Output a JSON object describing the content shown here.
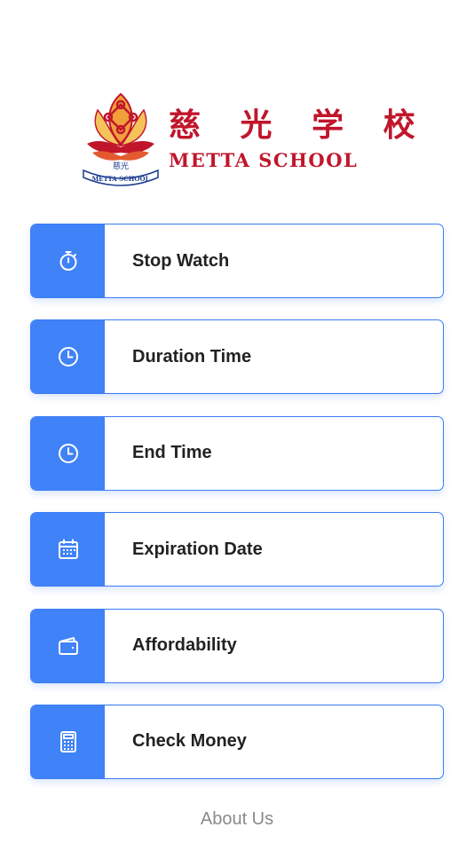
{
  "logo": {
    "chinese_name": "慈 光 学 校",
    "english_name": "METTA SCHOOL",
    "emblem_cn": "慈光",
    "emblem_banner": "METTA SCHOOL",
    "brand_color": "#c0162c"
  },
  "menu": {
    "accent_color": "#4082f7",
    "items": [
      {
        "label": "Stop Watch",
        "icon": "stopwatch-icon"
      },
      {
        "label": "Duration Time",
        "icon": "clock-icon"
      },
      {
        "label": "End Time",
        "icon": "clock-icon"
      },
      {
        "label": "Expiration Date",
        "icon": "calendar-icon"
      },
      {
        "label": "Affordability",
        "icon": "wallet-icon"
      },
      {
        "label": "Check Money",
        "icon": "calculator-icon"
      }
    ]
  },
  "footer": {
    "about_label": "About Us"
  }
}
